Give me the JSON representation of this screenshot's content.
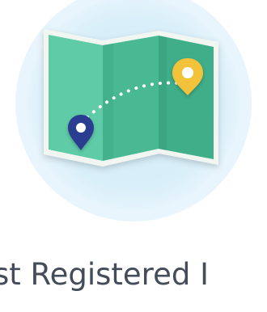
{
  "colors": {
    "halo_outer": "#e6f4fb",
    "halo_inner": "#d3ecf8",
    "map_fold_light": "#5fcba7",
    "map_fold_mid": "#48b994",
    "map_fold_dark": "#38a983",
    "map_border": "#f2f6f3",
    "route_dots": "#ffffff",
    "pin_start": "#2b3d91",
    "pin_end": "#f2c23a",
    "heading_text": "#434c58"
  },
  "icons": {
    "map": "folded-map-icon",
    "start_pin": "location-pin-icon",
    "end_pin": "location-pin-icon"
  },
  "heading": "st Registered I"
}
